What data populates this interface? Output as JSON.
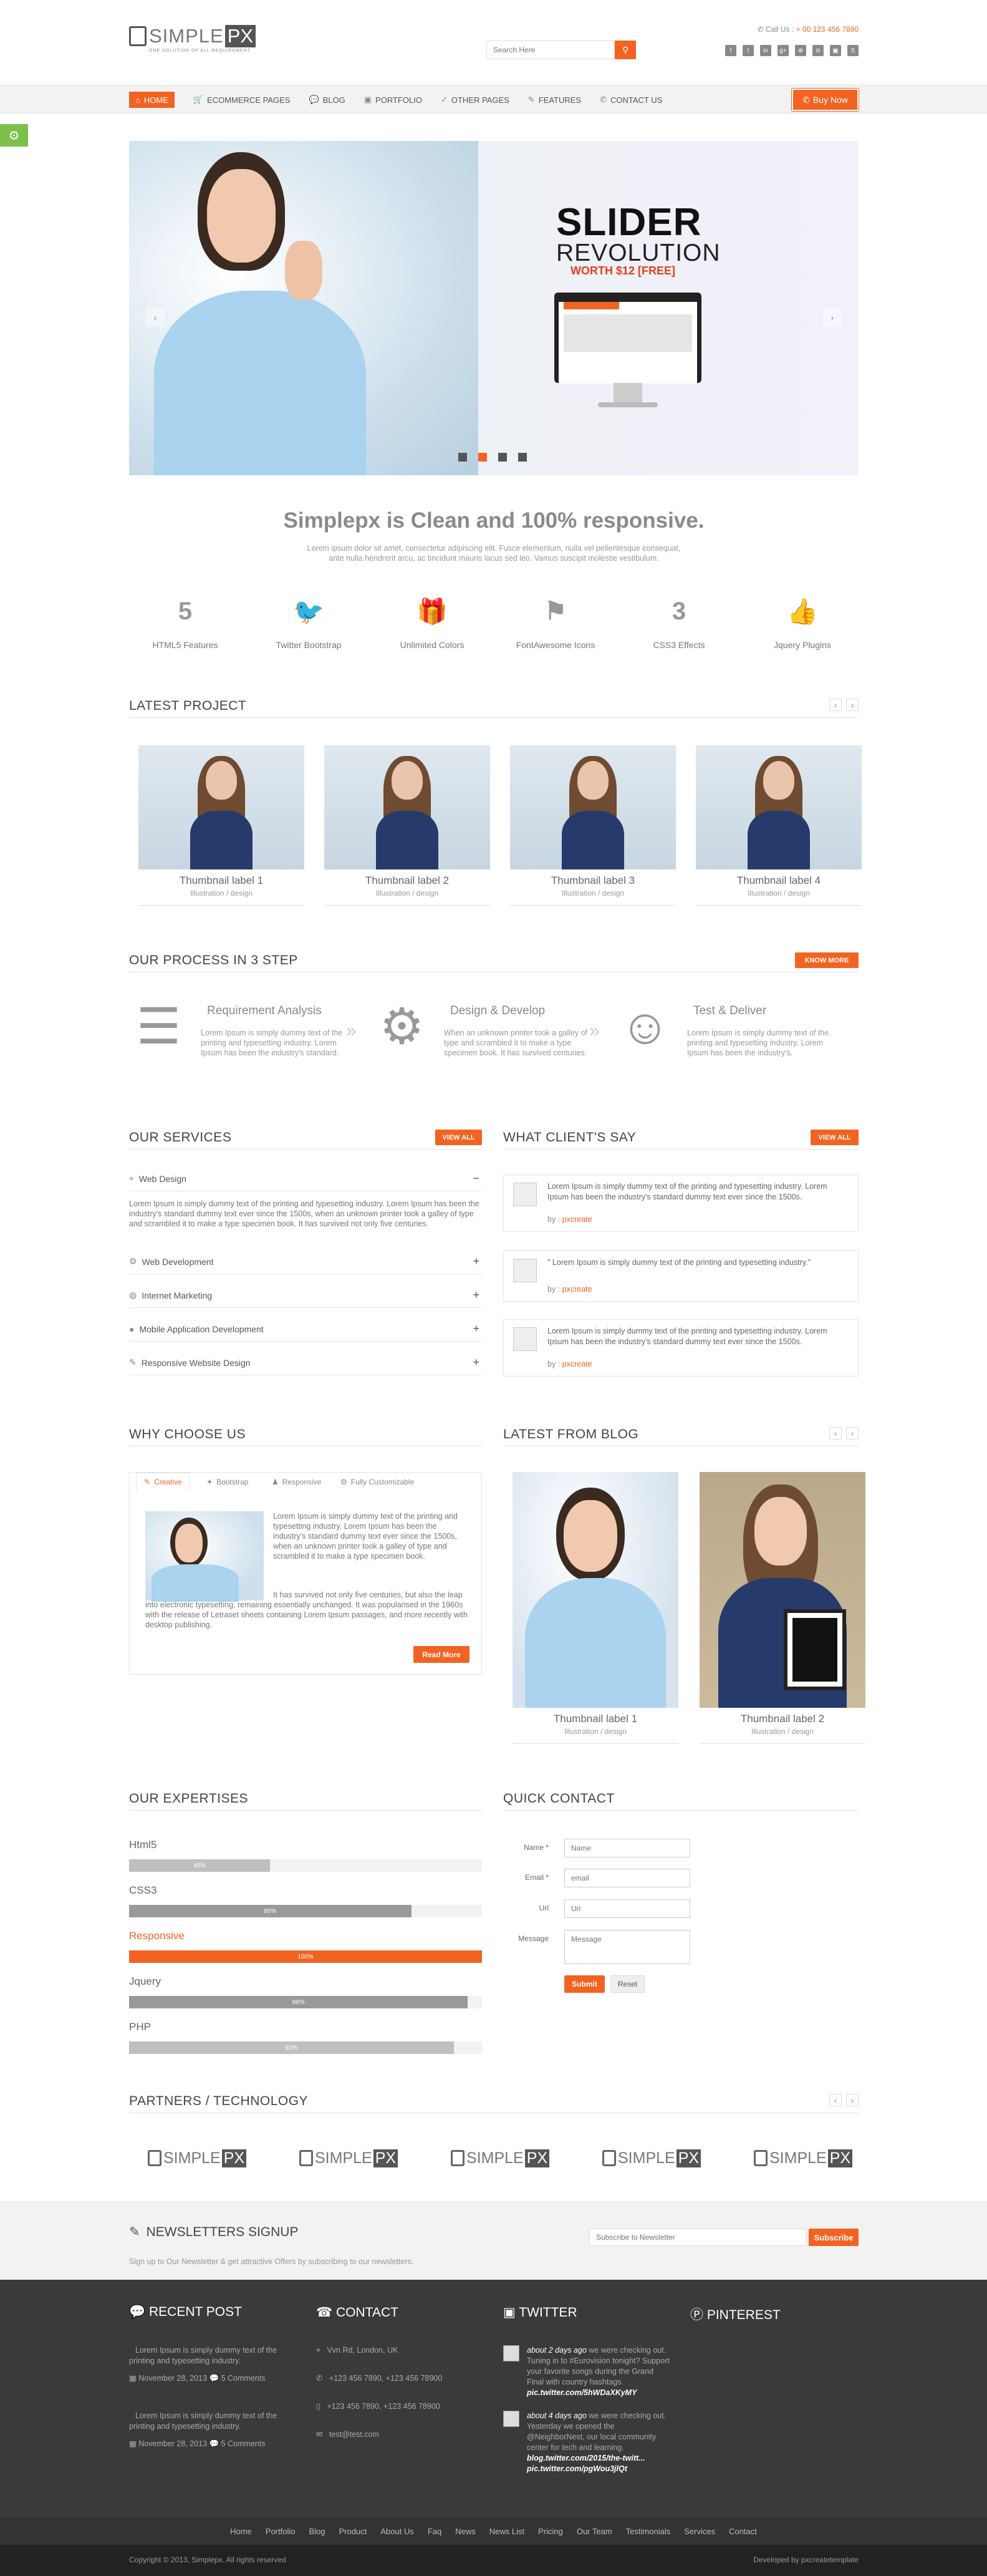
{
  "header": {
    "logo_word": "SIMPLE",
    "logo_word2": "PX",
    "logo_tagline": "ONE SOLUTION OF ALL REQUIREMENT",
    "search_placeholder": "Search Here",
    "call_label": "Call Us : ",
    "phone": "+ 00 123 456 7890",
    "socials": [
      "f",
      "t",
      "in",
      "g+",
      "⊕",
      "⊖",
      "▣",
      "S"
    ]
  },
  "nav": {
    "items": [
      {
        "label": "HOME",
        "icon": "home-icon",
        "glyph": "⌂"
      },
      {
        "label": "ECOMMERCE PAGES",
        "icon": "cart-icon",
        "glyph": "🛒"
      },
      {
        "label": "BLOG",
        "icon": "chat-icon",
        "glyph": "💬"
      },
      {
        "label": "PORTFOLIO",
        "icon": "portfolio-icon",
        "glyph": "▣"
      },
      {
        "label": "OTHER PAGES",
        "icon": "check-icon",
        "glyph": "✓"
      },
      {
        "label": "FEATURES",
        "icon": "pencil-icon",
        "glyph": "✎"
      },
      {
        "label": "CONTACT US",
        "icon": "phone-icon",
        "glyph": "✆"
      }
    ],
    "buy_label": "Buy Now"
  },
  "slider": {
    "title": "SLIDER",
    "subtitle": "REVOLUTION",
    "tag": "WORTH $12 [FREE]"
  },
  "intro": {
    "title": "Simplepx is Clean and 100% responsive.",
    "text1": "Lorem ipsum dolor sit amet, consectetur adipiscing elit. Fusce elementum, nulla vel pellentesque consequat,",
    "text2": "ante nulla hendrerit arcu, ac tincidunt mauris lacus sed leo. Vamus suscipit molestie vestibulum."
  },
  "features": [
    {
      "label": "HTML5 Features",
      "icon": "html5-icon",
      "glyph": "5"
    },
    {
      "label": "Twitter Bootstrap",
      "icon": "twitter-icon",
      "glyph": "🐦"
    },
    {
      "label": "Unlimited Colors",
      "icon": "gift-icon",
      "glyph": "🎁"
    },
    {
      "label": "FontAwesome Icons",
      "icon": "flag-icon",
      "glyph": "⚑"
    },
    {
      "label": "CSS3 Effects",
      "icon": "css3-icon",
      "glyph": "3"
    },
    {
      "label": "Jquery Plugins",
      "icon": "thumbs-up-icon",
      "glyph": "👍"
    }
  ],
  "latest_project": {
    "title": "LATEST PROJECT",
    "items": [
      {
        "label": "Thumbnail label 1",
        "sub": "Illustration / design"
      },
      {
        "label": "Thumbnail label 2",
        "sub": "Illustration / design"
      },
      {
        "label": "Thumbnail label 3",
        "sub": "Illustration / design"
      },
      {
        "label": "Thumbnail label 4",
        "sub": "Illustration / design"
      }
    ]
  },
  "process": {
    "title": "OUR PROCESS IN 3 STEP",
    "button": "KNOW MORE",
    "steps": [
      {
        "title": "Requirement Analysis",
        "text": "Lorem Ipsum is simply dummy text of the printing and typesetting industry. Lorem Ipsum has been the industry's standard."
      },
      {
        "title": "Design & Develop",
        "text": "When an unknown printer took a galley of type and scrambled it to make a type specimen book. It has survived centuries."
      },
      {
        "title": "Test & Deliver",
        "text": "Lorem Ipsum is simply dummy text of the printing and typesetting industry. Lorem Ipsum has been the industry's."
      }
    ]
  },
  "services": {
    "title": "OUR SERVICES",
    "button": "VIEW ALL",
    "open": {
      "label": "Web Design",
      "text": "Lorem Ipsum is simply dummy text of the printing and typesetting industry. Lorem Ipsum has been the industry's standard dummy text ever since the 1500s, when an unknown printer took a galley of type and scrambled it to make a type specimen book. It has survived not only five centuries."
    },
    "items": [
      "Web Development",
      "Internet Marketing",
      "Mobile Application Development",
      "Responsive Website Design"
    ]
  },
  "clients": {
    "title": "WHAT CLIENT'S SAY",
    "button": "VIEW ALL",
    "by": "by : ",
    "items": [
      {
        "text": "Lorem Ipsum is simply dummy text of the printing and typesetting industry. Lorem Ipsum has been the industry's standard dummy text ever since the 1500s.",
        "author": "pxcreate"
      },
      {
        "text": "\" Lorem Ipsum is simply dummy text of the printing and typesetting industry.\"",
        "author": "pxcreate"
      },
      {
        "text": "Lorem Ipsum is simply dummy text of the printing and typesetting industry. Lorem Ipsum has been the industry's standard dummy text ever since the 1500s.",
        "author": "pxcreate"
      }
    ]
  },
  "why": {
    "title": "WHY CHOOSE US",
    "tabs": [
      "Creative",
      "Bootstrap",
      "Responsive",
      "Fully Customizable"
    ],
    "p1": "Lorem Ipsum is simply dummy text of the printing and typesetting industry. Lorem Ipsum has been the industry's standard dummy text ever since the 1500s, when an unknown printer took a galley of type and scrambled it to make a type specimen book.",
    "p2": "It has survived not only five centuries, but also the leap into electronic typesetting, remaining essentially unchanged. It was popularised in the 1960s with the release of Letraset sheets containing Lorem Ipsum passages, and more recently with desktop publishing.",
    "button": "Read More"
  },
  "blog": {
    "title": "LATEST FROM BLOG",
    "items": [
      {
        "label": "Thumbnail label 1",
        "sub": "Illustration / design"
      },
      {
        "label": "Thumbnail label 2",
        "sub": "Illustration / design"
      }
    ]
  },
  "expertise": {
    "title": "OUR EXPERTISES",
    "items": [
      {
        "label": "Html5",
        "value": "40%",
        "pct": 40,
        "color": "#bfbfbf"
      },
      {
        "label": "CSS3",
        "value": "80%",
        "pct": 80,
        "color": "#999999"
      },
      {
        "label": "Responsive",
        "value": "100%",
        "pct": 100,
        "color": "#f26322"
      },
      {
        "label": "Jquery",
        "value": "96%",
        "pct": 96,
        "color": "#999999"
      },
      {
        "label": "PHP",
        "value": "92%",
        "pct": 92,
        "color": "#bfbfbf"
      }
    ]
  },
  "contact": {
    "title": "QUICK CONTACT",
    "fields": [
      {
        "label": "Name *",
        "placeholder": "Name"
      },
      {
        "label": "Email *",
        "placeholder": "email"
      },
      {
        "label": "Url",
        "placeholder": "Url"
      },
      {
        "label": "Message",
        "placeholder": "Message"
      }
    ],
    "submit": "Submit",
    "reset": "Reset"
  },
  "partners": {
    "title": "PARTNERS / TECHNOLOGY"
  },
  "newsletter": {
    "title": "NEWSLETTERS SIGNUP",
    "text": "Sign up to Our Newsletter & get attractive Offers by subscribing to our newsletters.",
    "placeholder": "Subscribe to Newsletter",
    "button": "Subscribe"
  },
  "footer": {
    "recent": {
      "title": "RECENT POST",
      "items": [
        {
          "text": "Lorem Ipsum is simply dummy text of the printing and typesetting industry.",
          "date": "November 28, 2013",
          "comments": "5 Comments"
        },
        {
          "text": "Lorem Ipsum is simply dummy text of the printing and typesetting industry.",
          "date": "November 28, 2013",
          "comments": "5 Comments"
        }
      ]
    },
    "contact": {
      "title": "CONTACT",
      "address": "Vvn Rd, London, UK",
      "phone1": "+123 456 7890, +123 456 78900",
      "phone2": "+123 456 7890, +123 456 78900",
      "email": "test@test.com"
    },
    "twitter": {
      "title": "TWITTER",
      "t1_time": "about 2 days ago",
      "t1_text": " we were checking out. Tuning in to #Eurovision tonight? Support your favorite songs during the Grand Final with country hashtags.",
      "t1_link": "pic.twitter.com/5hWDaXKyMY",
      "t2_time": "about 4 days ago",
      "t2_text": " we were checking out. Yesterday we opened the @NeighborNest, our local community center for tech and learning.",
      "t2_link": "blog.twitter.com/2015/the-twitt... pic.twitter.com/pgWou3jlQt"
    },
    "pinterest": {
      "title": "PINTEREST"
    },
    "links": [
      "Home",
      "Portfolio",
      "Blog",
      "Product",
      "About Us",
      "Faq",
      "News",
      "News List",
      "Pricing",
      "Our Team",
      "Testimonials",
      "Services",
      "Contact"
    ],
    "copyright": "Copyright © 2013, Simplepx. All rights reserved",
    "developer": "Developed by pxcreatetemplate"
  }
}
